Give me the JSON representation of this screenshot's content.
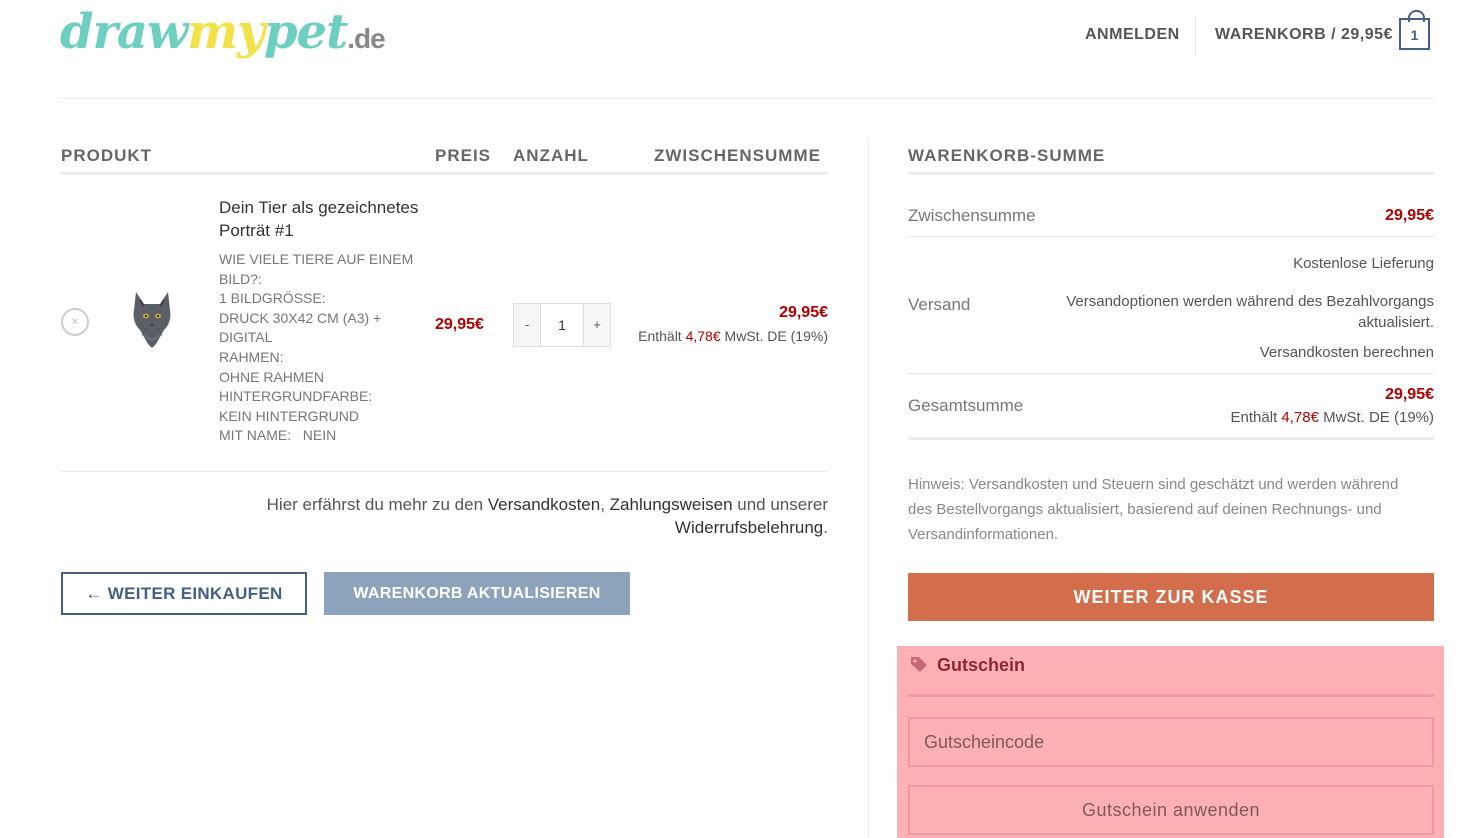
{
  "header": {
    "logo_part1": "draw",
    "logo_part2": "my",
    "logo_part3": "pet",
    "logo_part4": ".de",
    "login_label": "ANMELDEN",
    "cart_label": "WARENKORB / 29,95€",
    "cart_count": "1"
  },
  "table": {
    "col_product": "PRODUKT",
    "col_price": "PREIS",
    "col_quantity": "ANZAHL",
    "col_subtotal": "ZWISCHENSUMME"
  },
  "item": {
    "remove_symbol": "×",
    "name": "Dein Tier als gezeichnetes Porträt #1",
    "meta": [
      "Wie viele Tiere auf einem Bild?:",
      "1  Bildgröße:",
      "Druck 30x42 cm (A3) + Digital",
      "Rahmen:",
      "Ohne Rahmen",
      "Hintergrundfarbe:",
      "Kein Hintergrund",
      "Mit Name:   Nein"
    ],
    "price": "29,95€",
    "qty_minus": "-",
    "qty_value": "1",
    "qty_plus": "+",
    "subtotal": "29,95€",
    "tax_prefix": "Enthält ",
    "tax_amount": "4,78€",
    "tax_suffix": " MwSt. DE (19%)"
  },
  "info": {
    "text1": "Hier erfährst du mehr zu den ",
    "link1": "Versandkosten",
    "sep1": ", ",
    "link2": "Zahlungsweisen",
    "text2": " und unserer ",
    "link3": "Widerrufsbelehrung",
    "text3": "."
  },
  "buttons": {
    "continue_arrow": "←",
    "continue_label": " WEITER EINKAUFEN",
    "update_label": "WARENKORB AKTUALISIEREN"
  },
  "totals": {
    "title": "WARENKORB-SUMME",
    "subtotal_label": "Zwischensumme",
    "subtotal_value": "29,95€",
    "shipping_label": "Versand",
    "shipping_free": "Kostenlose Lieferung",
    "shipping_note_line1": "Versandoptionen werden während des Bezahlvorgangs",
    "shipping_note_line2": "aktualisiert.",
    "shipping_calc": "Versandkosten berechnen",
    "total_label": "Gesamtsumme",
    "total_value": "29,95€",
    "total_tax_prefix": "Enthält ",
    "total_tax_amount": "4,78€",
    "total_tax_suffix": " MwSt. DE (19%)",
    "note": "Hinweis: Versandkosten und Steuern sind geschätzt und werden während des Bestellvorgangs aktualisiert, basierend auf deinen Rechnungs- und Versandinformationen.",
    "checkout_label": "WEITER ZUR KASSE"
  },
  "coupon": {
    "icon": "tag-icon",
    "title": "Gutschein",
    "placeholder": "Gutscheincode",
    "apply_label": "Gutschein anwenden"
  },
  "colors": {
    "accent_blue": "#446084",
    "price_red": "#b20000",
    "checkout_orange": "#d26e4b",
    "coupon_highlight": "#ffb0b4"
  }
}
